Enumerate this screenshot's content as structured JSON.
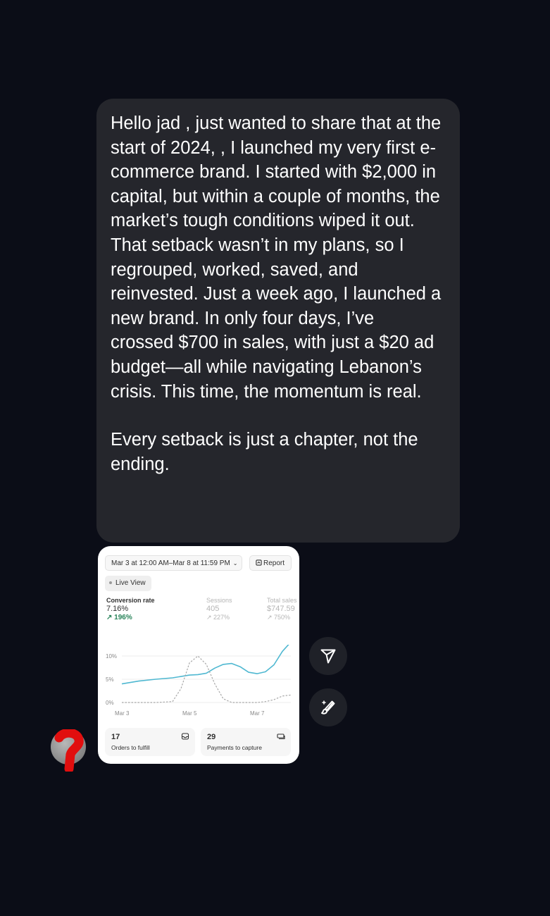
{
  "message": {
    "paragraph1": "Hello jad , just wanted to share that at the start of 2024, , I launched my very first e-commerce brand. I started with $2,000 in capital, but within a couple of months, the market’s tough conditions wiped it out. That setback wasn’t in my plans, so I regrouped, worked, saved, and reinvested. Just a week ago, I launched a new brand. In only four days, I’ve crossed $700 in sales, with just a $20 ad budget—all while navigating Lebanon’s crisis. This time, the momentum is real.",
    "paragraph2": "Every setback is just a chapter, not the ending."
  },
  "dashboard": {
    "date_range": "Mar 3 at 12:00 AM–Mar 8 at 11:59 PM",
    "report_label": "Report",
    "live_view_label": "Live View",
    "metrics": [
      {
        "label": "Conversion rate",
        "value": "7.16%",
        "change": "↗ 196%"
      },
      {
        "label": "Sessions",
        "value": "405",
        "change": "↗ 227%"
      },
      {
        "label": "Total sales",
        "value": "$747.59",
        "change": "↗ 750%"
      }
    ],
    "cards": [
      {
        "count": "17",
        "label": "Orders to fulfill"
      },
      {
        "count": "29",
        "label": "Payments to capture"
      }
    ]
  },
  "chart_data": {
    "type": "line",
    "y_ticks": [
      "10%",
      "5%",
      "0%"
    ],
    "x_ticks": [
      "Mar 3",
      "Mar 5",
      "Mar 7"
    ],
    "ylim": [
      0,
      12
    ],
    "xlim": [
      0,
      100
    ],
    "grid": true,
    "series": [
      {
        "style": "solid",
        "color": "#4fb8d1",
        "x": [
          0,
          10,
          20,
          30,
          40,
          45,
          50,
          55,
          60,
          65,
          70,
          75,
          80,
          85,
          90,
          95,
          100
        ],
        "values": [
          4.0,
          4.6,
          5.0,
          5.3,
          5.9,
          6.0,
          6.3,
          7.4,
          8.2,
          8.4,
          7.7,
          6.5,
          6.2,
          6.6,
          8.1,
          11.0,
          13.0
        ]
      },
      {
        "style": "dashed",
        "color": "#a8a8a8",
        "x": [
          0,
          10,
          20,
          30,
          35,
          40,
          45,
          50,
          55,
          60,
          65,
          70,
          75,
          80,
          85,
          90,
          95,
          100
        ],
        "values": [
          0.0,
          0.0,
          0.0,
          0.2,
          3.0,
          8.5,
          10.0,
          8.2,
          4.0,
          0.8,
          0.0,
          0.0,
          0.0,
          0.0,
          0.2,
          0.6,
          1.4,
          1.6
        ]
      }
    ]
  }
}
